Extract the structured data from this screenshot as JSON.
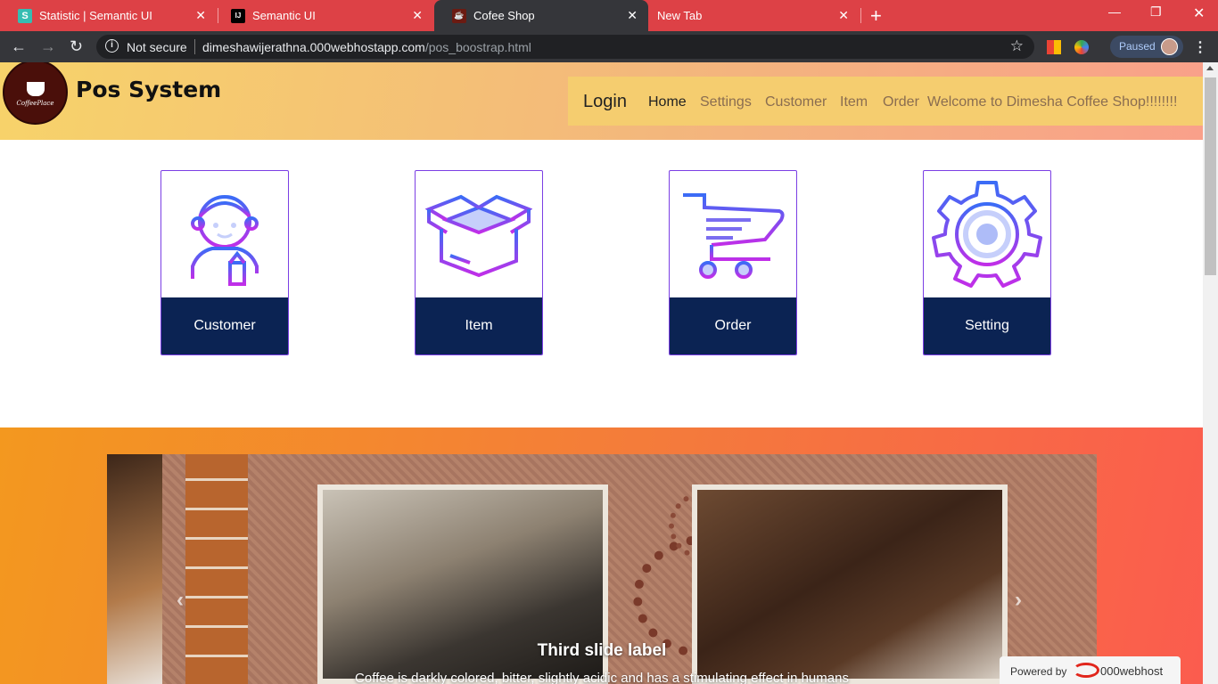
{
  "browser": {
    "tabs": [
      {
        "title": "Statistic | Semantic UI",
        "favicon": "S",
        "active": false
      },
      {
        "title": "Semantic UI",
        "favicon": "IJ",
        "active": false
      },
      {
        "title": "Cofee Shop",
        "favicon": "cup",
        "active": true
      },
      {
        "title": "New Tab",
        "favicon": "",
        "active": false
      }
    ],
    "security_label": "Not secure",
    "url_host": "dimeshawijerathna.000webhostapp.com",
    "url_path": "/pos_boostrap.html",
    "profile_status": "Paused"
  },
  "header": {
    "logo_text": "CoffeePlace",
    "brand": "Pos System",
    "login_label": "Login",
    "nav": [
      {
        "label": "Home",
        "active": true
      },
      {
        "label": "Settings",
        "active": false
      },
      {
        "label": "Customer",
        "active": false
      },
      {
        "label": "Item",
        "active": false
      },
      {
        "label": "Order",
        "active": false
      }
    ],
    "welcome": "Welcome to Dimesha Coffee Shop!!!!!!!!"
  },
  "cards": [
    {
      "label": "Customer",
      "icon": "customer-icon"
    },
    {
      "label": "Item",
      "icon": "box-icon"
    },
    {
      "label": "Order",
      "icon": "cart-icon"
    },
    {
      "label": "Setting",
      "icon": "gear-icon"
    }
  ],
  "carousel": {
    "caption_title": "Third slide label",
    "caption_text": "Coffee is darkly colored, bitter, slightly acidic and has a stimulating effect in humans"
  },
  "footer_badge": {
    "text": "Powered by",
    "name": "000webhost"
  },
  "colors": {
    "tabbar": "#dd4146",
    "card_footer": "#0b2353",
    "card_border": "#7b3fe4",
    "icon_gradient_start": "#3b6cf6",
    "icon_gradient_end": "#c12ee8"
  }
}
